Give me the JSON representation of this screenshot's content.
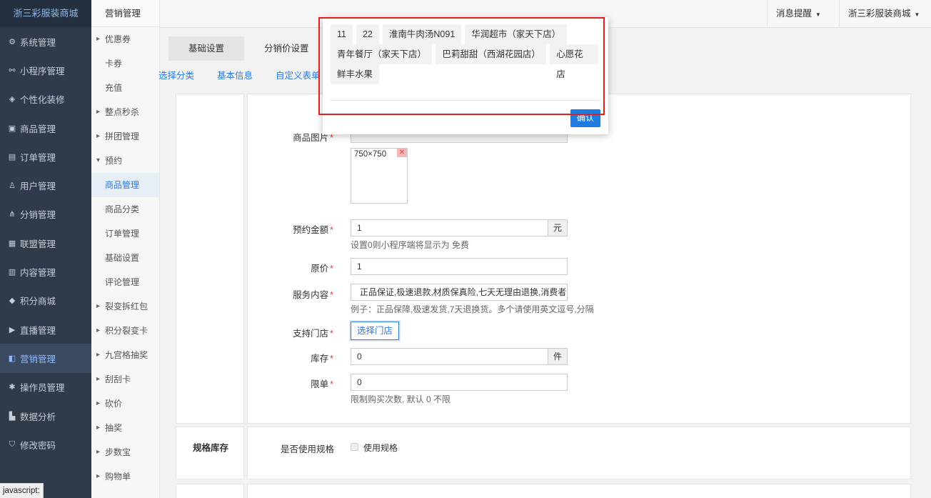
{
  "brand": "浙三彩服装商城",
  "sidebar": [
    {
      "label": "系统管理",
      "icon": "gear-icon",
      "glyph": "⚙"
    },
    {
      "label": "小程序管理",
      "icon": "link-icon",
      "glyph": "⚯"
    },
    {
      "label": "个性化装修",
      "icon": "palette-icon",
      "glyph": "◈"
    },
    {
      "label": "商品管理",
      "icon": "bag-icon",
      "glyph": "▣"
    },
    {
      "label": "订单管理",
      "icon": "clipboard-icon",
      "glyph": "▤"
    },
    {
      "label": "用户管理",
      "icon": "user-icon",
      "glyph": "♙"
    },
    {
      "label": "分销管理",
      "icon": "sitemap-icon",
      "glyph": "⋔"
    },
    {
      "label": "联盟管理",
      "icon": "store-icon",
      "glyph": "▦"
    },
    {
      "label": "内容管理",
      "icon": "article-icon",
      "glyph": "▥"
    },
    {
      "label": "积分商城",
      "icon": "box-icon",
      "glyph": "◆"
    },
    {
      "label": "直播管理",
      "icon": "play-icon",
      "glyph": "▶"
    },
    {
      "label": "营销管理",
      "icon": "megaphone-icon",
      "glyph": "◧"
    },
    {
      "label": "操作员管理",
      "icon": "cog-icon",
      "glyph": "✱"
    },
    {
      "label": "数据分析",
      "icon": "bar-chart-icon",
      "glyph": "▙"
    },
    {
      "label": "修改密码",
      "icon": "shield-icon",
      "glyph": "⛉"
    }
  ],
  "submenu": {
    "title": "营销管理",
    "items": [
      {
        "label": "优惠券",
        "type": "group"
      },
      {
        "label": "卡券",
        "type": "item"
      },
      {
        "label": "充值",
        "type": "item"
      },
      {
        "label": "整点秒杀",
        "type": "group"
      },
      {
        "label": "拼团管理",
        "type": "group"
      },
      {
        "label": "预约",
        "type": "open"
      },
      {
        "label": "商品管理",
        "type": "active"
      },
      {
        "label": "商品分类",
        "type": "item"
      },
      {
        "label": "订单管理",
        "type": "item"
      },
      {
        "label": "基础设置",
        "type": "item"
      },
      {
        "label": "评论管理",
        "type": "item"
      },
      {
        "label": "裂变拆红包",
        "type": "group"
      },
      {
        "label": "积分裂变卡",
        "type": "group"
      },
      {
        "label": "九宫格抽奖",
        "type": "group"
      },
      {
        "label": "刮刮卡",
        "type": "group"
      },
      {
        "label": "砍价",
        "type": "group"
      },
      {
        "label": "抽奖",
        "type": "group"
      },
      {
        "label": "步数宝",
        "type": "group"
      },
      {
        "label": "购物单",
        "type": "group"
      }
    ]
  },
  "topbar": {
    "notifications": "消息提醒",
    "account": "浙三彩服装商城"
  },
  "tabs": [
    "基础设置",
    "分销价设置"
  ],
  "subtabs": [
    "选择分类",
    "基本信息",
    "自定义表单"
  ],
  "form": {
    "image_label": "商品图片",
    "image_size": "750×750",
    "deposit_label": "预约金额",
    "deposit_value": "1",
    "deposit_unit": "元",
    "deposit_hint": "设置0则小程序端将显示为 免费",
    "original_label": "原价",
    "original_value": "1",
    "service_label": "服务内容",
    "service_value": "正品保证,极速退款,材质保真险,七天无理由退换,消费者",
    "service_hint": "例子：正品保障,极速发货,7天退换货。多个请使用英文逗号,分隔",
    "stores_label": "支持门店",
    "stores_button": "选择门店",
    "stock_label": "库存",
    "stock_value": "0",
    "stock_unit": "件",
    "limit_label": "限单",
    "limit_value": "0",
    "limit_hint": "限制购买次数, 默认 0 不限",
    "spec_section": "规格库存",
    "spec_label": "是否使用规格",
    "spec_checkbox": "使用规格"
  },
  "modal": {
    "stores": [
      "11",
      "22",
      "淮南牛肉汤N091",
      "华润超市（家天下店）",
      "青年餐厅（家天下店）",
      "巴莉甜甜（西湖花园店）",
      "心愿花店",
      "鲜丰水果"
    ],
    "confirm": "确认"
  },
  "status_url": "javascript:",
  "colors": {
    "accent": "#2c7be5",
    "sidebar_bg": "#2f3a4a",
    "highlight": "#e02020"
  }
}
